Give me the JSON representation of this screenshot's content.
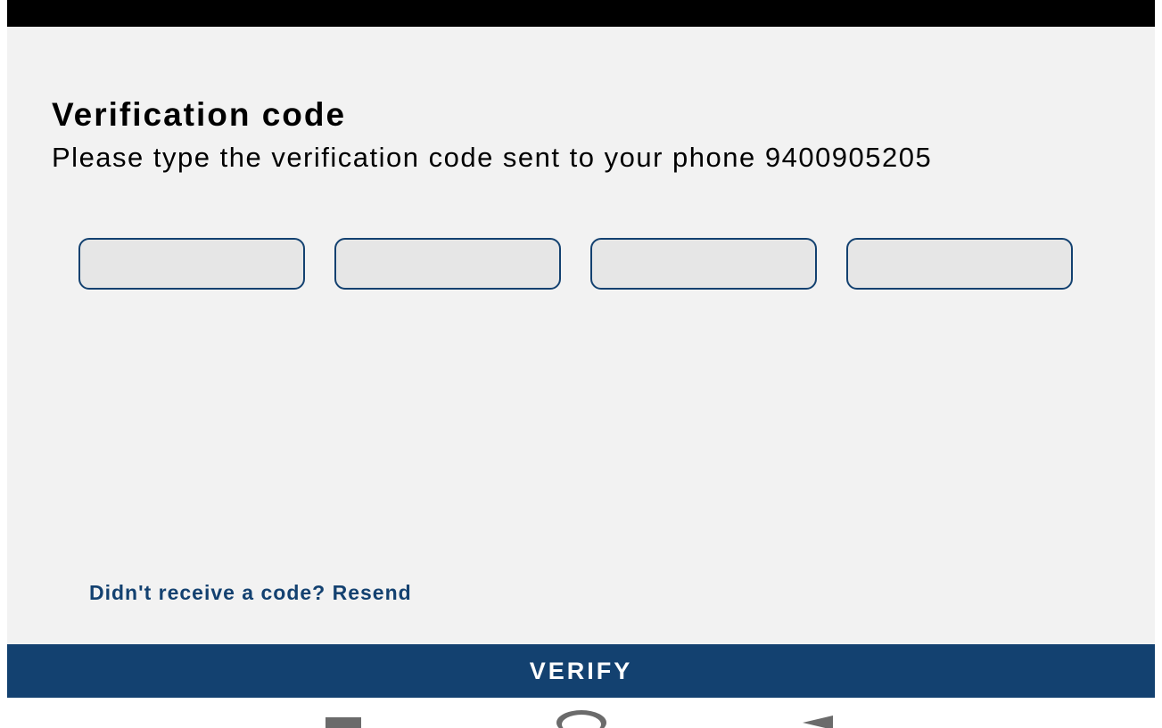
{
  "screen": {
    "title": "Verification code",
    "subtitle": "Please type the verification code sent to your phone 9400905205"
  },
  "code_inputs": [
    {
      "value": "",
      "placeholder": ""
    },
    {
      "value": "",
      "placeholder": ""
    },
    {
      "value": "",
      "placeholder": ""
    },
    {
      "value": "",
      "placeholder": ""
    }
  ],
  "resend_link": "Didn't receive a code? Resend",
  "verify_button": "VERIFY",
  "nav_bar": {
    "recents_icon": "square-icon",
    "home_icon": "circle-icon",
    "back_icon": "triangle-back-icon"
  },
  "colors": {
    "accent": "#134170",
    "background": "#f2f2f2",
    "input_fill": "#e6e6e6",
    "status_bar": "#000000"
  }
}
